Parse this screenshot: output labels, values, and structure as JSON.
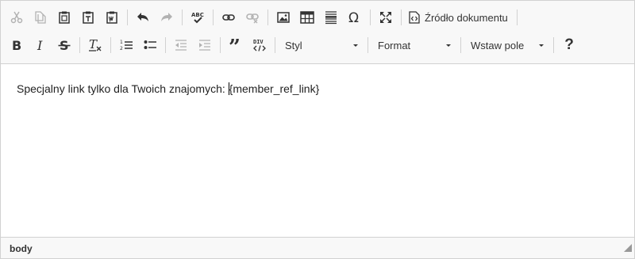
{
  "toolbar": {
    "row1": {
      "source_label": "Źródło dokumentu"
    },
    "row2": {
      "style_combo": "Styl",
      "format_combo": "Format",
      "insert_field_combo": "Wstaw pole",
      "help_label": "?"
    }
  },
  "content": {
    "text_before": "Specjalny link tylko dla Twoich znajomych: ",
    "text_after": "{member_ref_link}"
  },
  "statusbar": {
    "path": "body"
  },
  "colors": {
    "toolbar_bg": "#f8f8f8",
    "border": "#d1d1d1",
    "icon": "#333333",
    "disabled_icon": "#b5b5b5"
  },
  "icons": [
    "cut-icon",
    "copy-icon",
    "paste-icon",
    "paste-text-icon",
    "paste-word-icon",
    "undo-icon",
    "redo-icon",
    "spellcheck-icon",
    "link-icon",
    "unlink-icon",
    "image-icon",
    "table-icon",
    "horizontal-line-icon",
    "special-char-icon",
    "maximize-icon",
    "source-icon",
    "bold-icon",
    "italic-icon",
    "strike-icon",
    "remove-format-icon",
    "numbered-list-icon",
    "bulleted-list-icon",
    "outdent-icon",
    "indent-icon",
    "blockquote-icon",
    "div-icon",
    "help-icon"
  ]
}
